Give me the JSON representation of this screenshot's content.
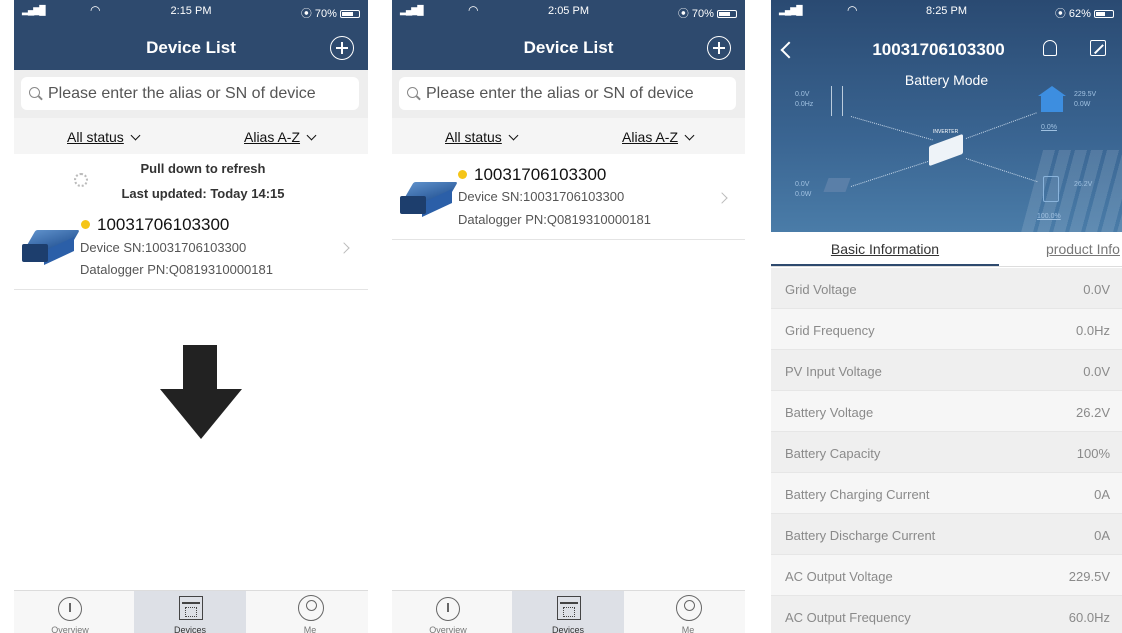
{
  "panel1": {
    "status": {
      "time": "2:15 PM",
      "battery": "70%",
      "battery_fill": 0.7
    },
    "title": "Device List",
    "search_placeholder": "Please enter the alias or SN of device",
    "filter_status": "All status",
    "filter_sort": "Alias A-Z",
    "refresh_hint": "Pull down to refresh",
    "last_updated": "Last updated: Today 14:15",
    "device": {
      "name": "10031706103300",
      "sn": "Device SN:10031706103300",
      "pn": "Datalogger PN:Q0819310000181"
    },
    "tabs": [
      "Overview",
      "Devices",
      "Me"
    ]
  },
  "panel2": {
    "status": {
      "time": "2:05 PM",
      "battery": "70%",
      "battery_fill": 0.7
    },
    "title": "Device List",
    "search_placeholder": "Please enter the alias or SN of device",
    "filter_status": "All status",
    "filter_sort": "Alias A-Z",
    "device": {
      "name": "10031706103300",
      "sn": "Device SN:10031706103300",
      "pn": "Datalogger PN:Q0819310000181"
    },
    "tabs": [
      "Overview",
      "Devices",
      "Me"
    ]
  },
  "panel3": {
    "status": {
      "time": "8:25 PM",
      "battery": "62%",
      "battery_fill": 0.62
    },
    "title": "10031706103300",
    "mode": "Battery Mode",
    "diagram": {
      "grid_v": "0.0V",
      "grid_hz": "0.0Hz",
      "load_v": "229.5V",
      "load_w": "0.0W",
      "load_pct": "0.0%",
      "pv_v": "0.0V",
      "pv_w": "0.0W",
      "batt_v": "26.2V",
      "batt_pct": "100.0%",
      "inverter_label": "INVERTER"
    },
    "tab_basic": "Basic Information",
    "tab_product": "product Info",
    "rows": [
      {
        "label": "Grid Voltage",
        "value": "0.0V"
      },
      {
        "label": "Grid Frequency",
        "value": "0.0Hz"
      },
      {
        "label": "PV Input Voltage",
        "value": "0.0V"
      },
      {
        "label": "Battery Voltage",
        "value": "26.2V"
      },
      {
        "label": "Battery Capacity",
        "value": "100%"
      },
      {
        "label": "Battery Charging Current",
        "value": "0A"
      },
      {
        "label": "Battery Discharge Current",
        "value": "0A"
      },
      {
        "label": "AC Output Voltage",
        "value": "229.5V"
      },
      {
        "label": "AC Output Frequency",
        "value": "60.0Hz"
      }
    ]
  },
  "colors": {
    "header": "#2e4a6e",
    "status_dot": "#f5c518"
  }
}
